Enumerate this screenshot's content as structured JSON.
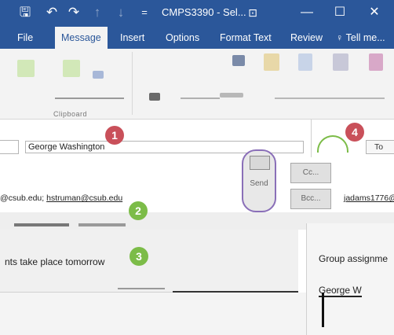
{
  "window": {
    "title": "CMPS3390 - Sel...",
    "minimize_glyph": "—",
    "restore_glyph": "☐",
    "close_glyph": "✕"
  },
  "qat": {
    "save_glyph": "🖫",
    "undo_glyph": "↶",
    "redo_glyph": "↷",
    "up_glyph": "↑",
    "down_glyph": "↓",
    "customize_glyph": "=",
    "restore_icon_glyph": "⊡"
  },
  "tabs": [
    {
      "label": "File"
    },
    {
      "label": "Message"
    },
    {
      "label": "Insert"
    },
    {
      "label": "Options"
    },
    {
      "label": "Format Text"
    },
    {
      "label": "Review"
    },
    {
      "label": "Tell me..."
    }
  ],
  "tell_me_glyph": "♀",
  "ribbon": {
    "clipboard_label": "Clipboard"
  },
  "compose": {
    "name_field_value": "George Washington",
    "recipients_prefix": "@csub.edu; ",
    "recipients_link": "hstruman@csub.edu",
    "right_email": "jadams1776@",
    "send_label": "Send",
    "cc_label": "Cc...",
    "bcc_label": "Bcc...",
    "to_label": "To",
    "subject_text": "nts take place tomorrow",
    "group_text": "Group assignme",
    "george_text": "George W"
  },
  "badges": {
    "one": "1",
    "two": "2",
    "three": "3",
    "four": "4"
  },
  "colors": {
    "title_bar": "#2b579a",
    "badge_red": "#c9505a",
    "badge_green": "#7cbc48",
    "send_border": "#8a6fb8"
  }
}
